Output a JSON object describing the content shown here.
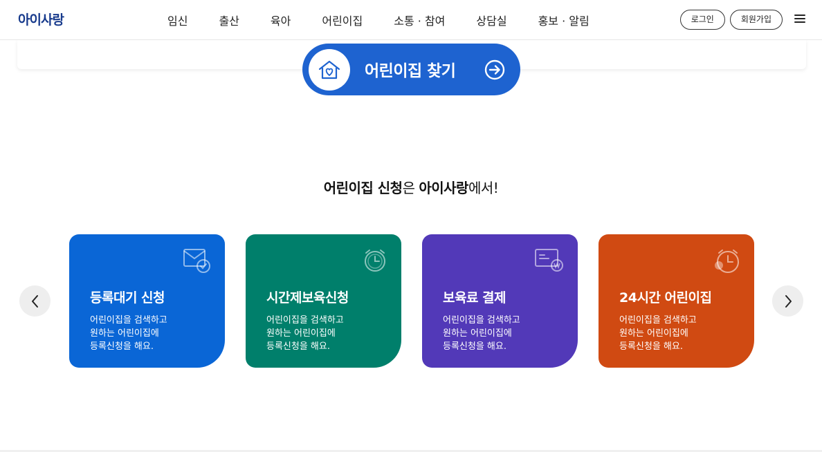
{
  "header": {
    "logo": "아이사랑",
    "nav": [
      "임신",
      "출산",
      "육아",
      "어린이집",
      "소통 · 참여",
      "상담실",
      "홍보 · 알림"
    ],
    "login_label": "로그인",
    "signup_label": "회원가입"
  },
  "search": {
    "find_label": "어린이집 찾기"
  },
  "section": {
    "title_bold1": "어린이집 신청",
    "title_part1": "은 ",
    "title_bold2": "아이사랑",
    "title_part2": "에서!"
  },
  "cards": [
    {
      "title": "등록대기 신청",
      "desc": [
        "어린이집을 검색하고",
        "원하는 어린이집에",
        "등록신청을 해요."
      ],
      "color": "#0a66d6",
      "icon": "envelope-check-icon"
    },
    {
      "title": "시간제보육신청",
      "desc": [
        "어린이집을 검색하고",
        "원하는 어린이집에",
        "등록신청을 해요."
      ],
      "color": "#007f6b",
      "icon": "alarm-clock-icon"
    },
    {
      "title": "보육료 결제",
      "desc": [
        "어린이집을 검색하고",
        "원하는 어린이집에",
        "등록신청을 해요."
      ],
      "color": "#5239b8",
      "icon": "payment-card-icon"
    },
    {
      "title": "24시간 어린이집",
      "desc": [
        "어린이집을 검색하고",
        "원하는 어린이집에",
        "등록신청을 해요."
      ],
      "color": "#d04a12",
      "icon": "clock-24-icon"
    }
  ]
}
